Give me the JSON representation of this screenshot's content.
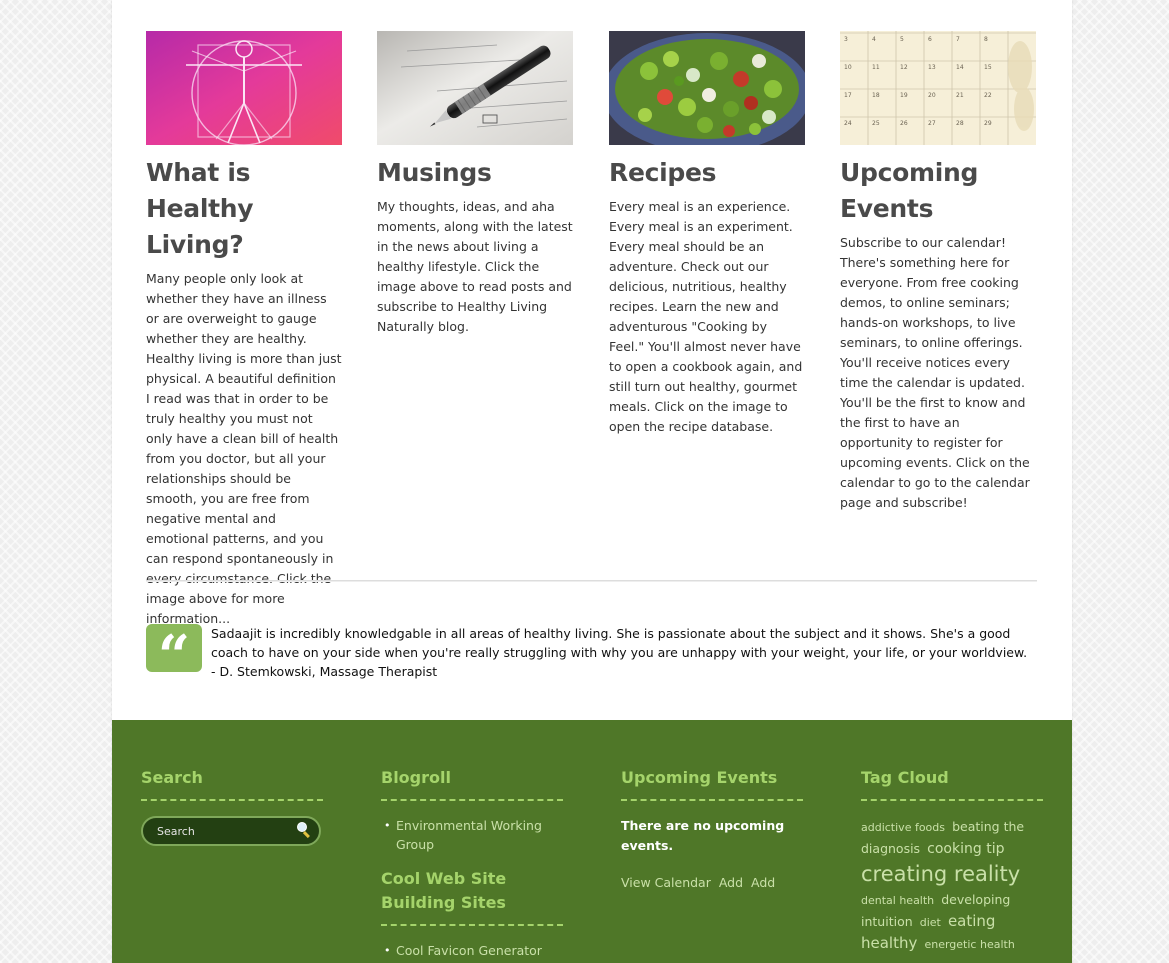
{
  "features": [
    {
      "title": "What is Healthy Living?",
      "image_icon": "vitruvian-man-image",
      "text": "Many people only look at whether they have an illness or are overweight to gauge whether they are healthy. Healthy living is more than just physical. A beautiful definition I read was that in order to be truly healthy you must not only have a clean bill of health from you doctor, but all your relationships should be smooth, you are free from negative mental and emotional patterns, and you can respond spontaneously in every circumstance. Click the image above for more information..."
    },
    {
      "title": "Musings",
      "image_icon": "pen-on-paper-image",
      "text": "My thoughts, ideas, and aha moments, along with the latest in the news about living a healthy lifestyle. Click the image above to read posts and subscribe to Healthy Living Naturally blog."
    },
    {
      "title": "Recipes",
      "image_icon": "salad-bowl-image",
      "text": "Every meal is an experience. Every meal is an experiment. Every meal should be an adventure. Check out our delicious, nutritious, healthy recipes. Learn the new and adventurous \"Cooking by Feel.\" You'll almost never have to open a cookbook again, and still turn out healthy, gourmet meals. Click on the image to open the recipe database."
    },
    {
      "title": "Upcoming Events",
      "image_icon": "calendar-image",
      "text": "Subscribe to our calendar! There's something here for everyone. From free cooking demos, to online seminars; hands-on workshops, to live seminars, to online offerings. You'll receive notices every time the calendar is updated. You'll be the first to know and the first to have an opportunity to register for upcoming events. Click on the calendar to go to the calendar page and subscribe!"
    }
  ],
  "testimonial": {
    "icon": "quote-icon",
    "text": "Sadaajit is incredibly knowledgable in all areas of healthy living. She is passionate about the subject and it shows. She's a good coach to have on your side when you're really struggling with why you are unhappy with your weight, your life, or your worldview. - D. Stemkowski, Massage Therapist"
  },
  "footer": {
    "search": {
      "heading": "Search",
      "placeholder": "Search",
      "button_icon": "magnifier-icon"
    },
    "blogroll": {
      "heading": "Blogroll",
      "links": [
        "Environmental Working Group"
      ],
      "cool_heading": "Cool Web Site Building Sites",
      "cool_links": [
        "Cool Favicon Generator"
      ]
    },
    "events": {
      "heading": "Upcoming Events",
      "empty_message": "There are no upcoming events.",
      "view_calendar": "View Calendar",
      "add1": "Add",
      "add2": "Add"
    },
    "tag_cloud": {
      "heading": "Tag Cloud",
      "tags": [
        {
          "label": "addictive foods",
          "size": "small"
        },
        {
          "label": "beating the diagnosis",
          "size": "medium"
        },
        {
          "label": "cooking tip",
          "size": "large"
        },
        {
          "label": "creating reality",
          "size": "xlarge"
        },
        {
          "label": "dental health",
          "size": "small"
        },
        {
          "label": "developing intuition",
          "size": "medium"
        },
        {
          "label": "diet",
          "size": "small"
        },
        {
          "label": "eating healthy",
          "size": "large"
        },
        {
          "label": "energetic health",
          "size": "small"
        }
      ]
    }
  },
  "colors": {
    "footer_bg": "#4f7728",
    "footer_heading": "#a5d46b",
    "quote_badge": "#8cba5b",
    "feature_title": "#4a4a4a"
  }
}
